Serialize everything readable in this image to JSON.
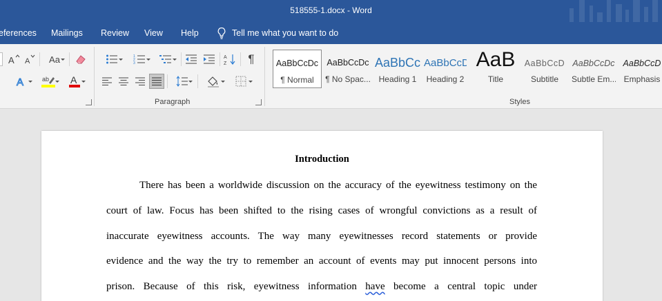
{
  "window": {
    "title": "518555-1.docx  -  Word"
  },
  "menu": {
    "tabs": [
      "eferences",
      "Mailings",
      "Review",
      "View",
      "Help"
    ],
    "tell_me": "Tell me what you want to do"
  },
  "ribbon": {
    "font_group": {
      "change_case_label": "Aa"
    },
    "paragraph_group": {
      "label": "Paragraph",
      "pilcrow": "¶"
    },
    "styles_group": {
      "label": "Styles",
      "items": [
        {
          "preview": "AaBbCcDc",
          "name": "¶ Normal"
        },
        {
          "preview": "AaBbCcDc",
          "name": "¶ No Spac..."
        },
        {
          "preview": "AaBbCc",
          "name": "Heading 1"
        },
        {
          "preview": "AaBbCcD",
          "name": "Heading 2"
        },
        {
          "preview": "AaB",
          "name": "Title"
        },
        {
          "preview": "AaBbCcD",
          "name": "Subtitle"
        },
        {
          "preview": "AaBbCcDc",
          "name": "Subtle Em..."
        },
        {
          "preview": "AaBbCcD",
          "name": "Emphasis"
        }
      ]
    }
  },
  "colors": {
    "accent": "#2b579a",
    "highlight": "#ffff00",
    "font_color": "#e00000",
    "spell_underline": "#2b5fd9"
  },
  "document": {
    "heading": "Introduction",
    "lines": [
      "There has been a worldwide discussion on the accuracy of the eyewitness testimony on the",
      "court of law. Focus has been shifted to the rising cases of wrongful convictions as a result of",
      "inaccurate eyewitness accounts. The way many eyewitnesses record statements or provide",
      "evidence and the way the try to remember an account of events may put innocent persons into"
    ],
    "line5": {
      "before": "prison. Because of this risk, eyewitness information ",
      "flagged": "have",
      "after": " become a central topic under"
    }
  }
}
